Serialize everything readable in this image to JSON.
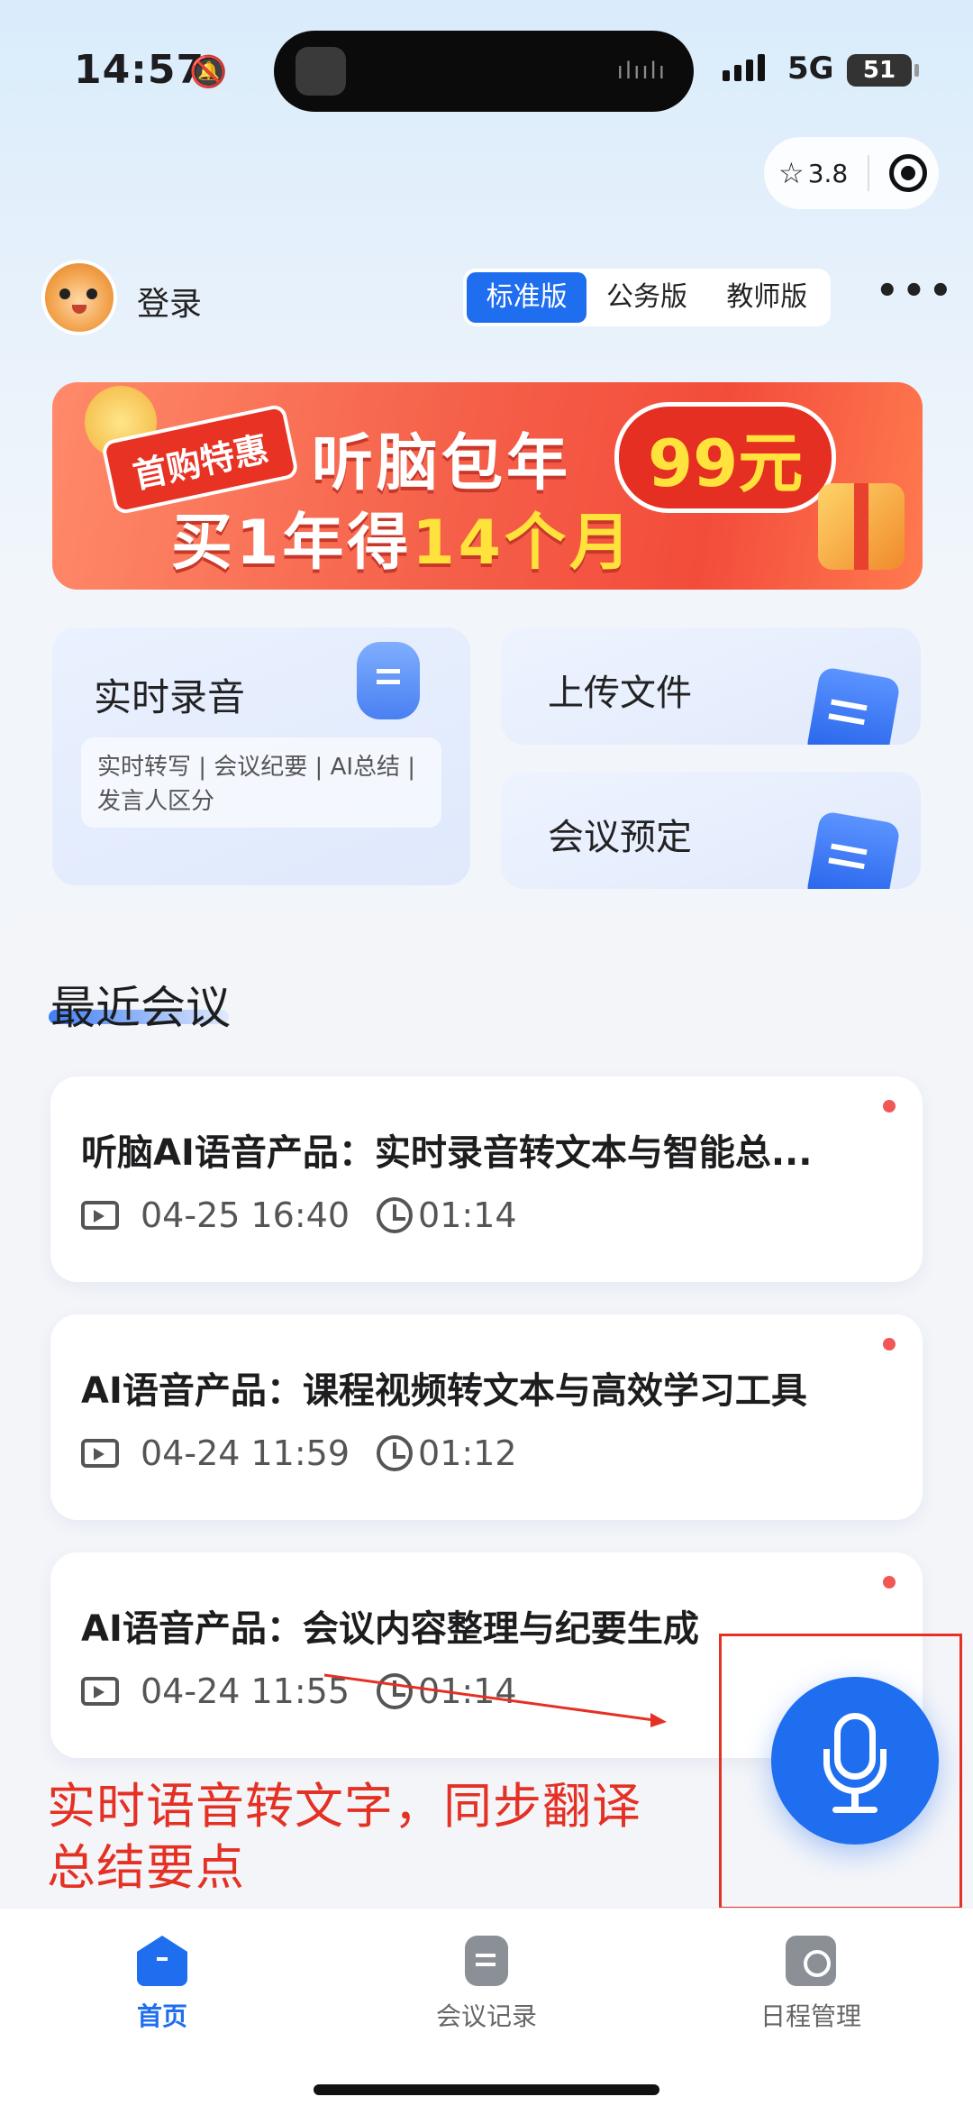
{
  "status_bar": {
    "time": "14:57",
    "network": "5G",
    "battery": "51"
  },
  "capsule": {
    "rating": "3.8"
  },
  "header": {
    "login": "登录",
    "editions": [
      "标准版",
      "公务版",
      "教师版"
    ],
    "more": "•••"
  },
  "banner": {
    "tag": "首购特惠",
    "line1": "听脑包年",
    "price": "99元",
    "line2_prefix": "买1年得",
    "line2_highlight": "14个月"
  },
  "features": {
    "realtime": {
      "title": "实时录音",
      "desc": "实时转写 | 会议纪要 | AI总结 | 发言人区分"
    },
    "upload": {
      "title": "上传文件"
    },
    "booking": {
      "title": "会议预定"
    }
  },
  "recent": {
    "title": "最近会议",
    "meetings": [
      {
        "title": "听脑AI语音产品：实时录音转文本与智能总...",
        "datetime": "04-25 16:40",
        "duration": "01:14"
      },
      {
        "title": "AI语音产品：课程视频转文本与高效学习工具",
        "datetime": "04-24 11:59",
        "duration": "01:12"
      },
      {
        "title": "AI语音产品：会议内容整理与纪要生成",
        "datetime": "04-24 11:55",
        "duration": "01:14"
      }
    ]
  },
  "annotation": {
    "line1": "实时语音转文字，同步翻译",
    "line2": "总结要点",
    "color": "#e53024"
  },
  "tabbar": {
    "items": [
      "首页",
      "会议记录",
      "日程管理"
    ],
    "active_color": "#1f6ef0"
  }
}
